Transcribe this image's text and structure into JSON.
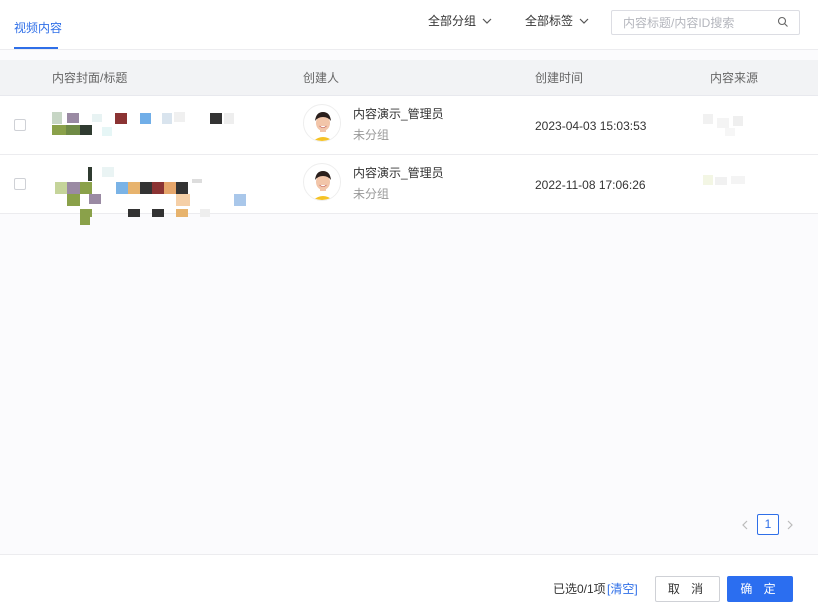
{
  "tabs": {
    "active_label": "视频内容"
  },
  "filters": {
    "group_label": "全部分组",
    "tag_label": "全部标签",
    "search_placeholder": "内容标题/内容ID搜索",
    "search_value": ""
  },
  "table": {
    "headers": [
      "内容封面/标题",
      "创建人",
      "创建时间",
      "内容来源"
    ],
    "rows": [
      {
        "creator_name": "内容演示_管理员",
        "creator_group": "未分组",
        "created_time": "2023-04-03 15:03:53",
        "checked": false
      },
      {
        "creator_name": "内容演示_管理员",
        "creator_group": "未分组",
        "created_time": "2022-11-08 17:06:26",
        "checked": false
      }
    ]
  },
  "pagination": {
    "current_page": "1"
  },
  "footer": {
    "selected_count": "已选0/1项",
    "clear_label": "[清空]",
    "cancel_label": "取 消",
    "confirm_label": "确 定"
  },
  "colors": {
    "accent": "#2f6fe8",
    "primary_button": "#2b6ef0",
    "header_bg": "#f2f3f5"
  },
  "icons": {
    "dropdown": "chevron-down-icon",
    "search": "search-icon",
    "prev": "chevron-left-icon",
    "next": "chevron-right-icon"
  }
}
